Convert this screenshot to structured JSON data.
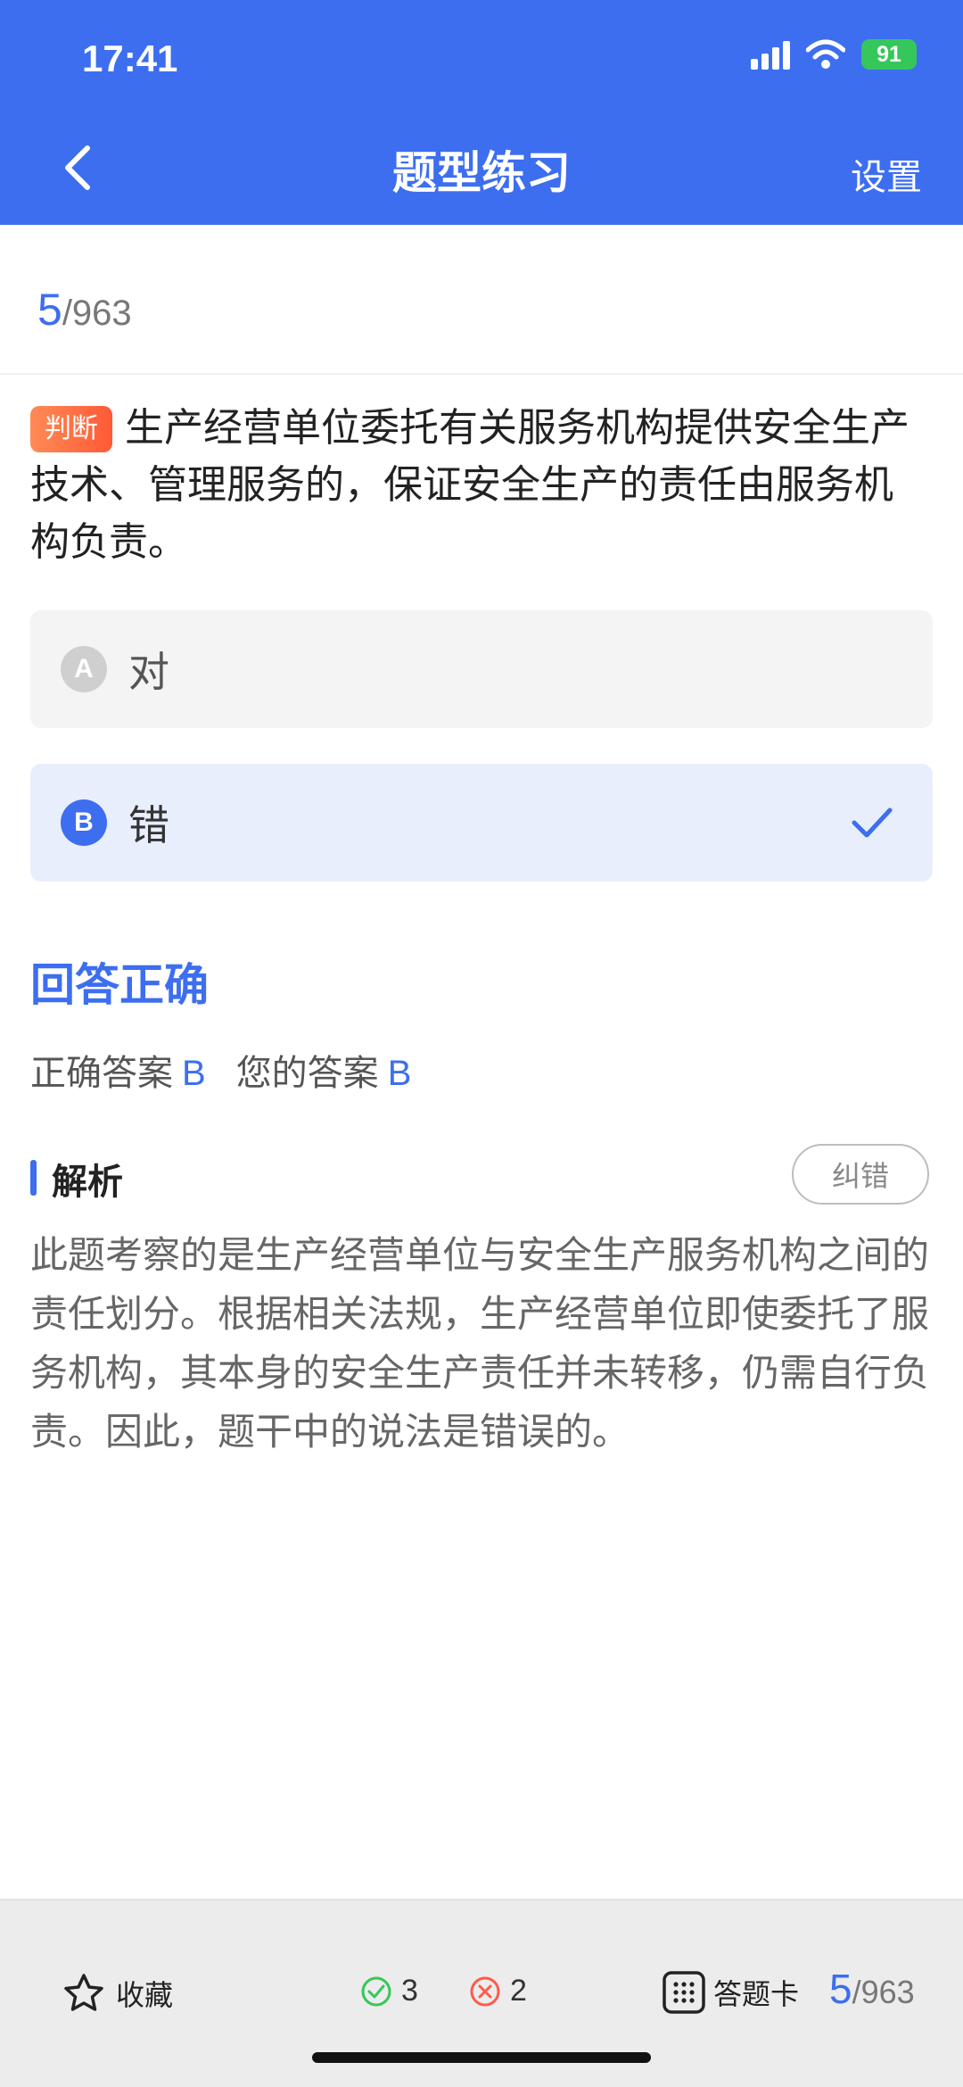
{
  "status": {
    "time": "17:41",
    "battery": "91"
  },
  "nav": {
    "title": "题型练习",
    "settings_label": "设置"
  },
  "progress": {
    "current": "5",
    "total": "/963"
  },
  "question": {
    "tag": "判断",
    "text": "生产经营单位委托有关服务机构提供安全生产技术、管理服务的，保证安全生产的责任由服务机构负责。"
  },
  "options": [
    {
      "letter": "A",
      "text": "对",
      "selected": false
    },
    {
      "letter": "B",
      "text": "错",
      "selected": true
    }
  ],
  "result": {
    "title": "回答正确",
    "correct_label": "正确答案",
    "correct_value": "B",
    "yours_label": "您的答案",
    "yours_value": "B"
  },
  "analysis": {
    "title": "解析",
    "report_label": "纠错",
    "body": "此题考察的是生产经营单位与安全生产服务机构之间的责任划分。根据相关法规，生产经营单位即使委托了服务机构，其本身的安全生产责任并未转移，仍需自行负责。因此，题干中的说法是错误的。"
  },
  "bottom_bar": {
    "favorite_label": "收藏",
    "right_count": "3",
    "wrong_count": "2",
    "card_label": "答题卡",
    "progress_current": "5",
    "progress_total": "/963"
  },
  "colors": {
    "primary": "#3d6ef0",
    "tag": "#ff6a3d",
    "right": "#35c759",
    "wrong": "#ff5a4a"
  },
  "icons": [
    "back-arrow-icon",
    "signal-icon",
    "wifi-icon",
    "battery-icon",
    "check-icon",
    "star-icon",
    "check-circle-icon",
    "cross-circle-icon",
    "grid-icon"
  ]
}
